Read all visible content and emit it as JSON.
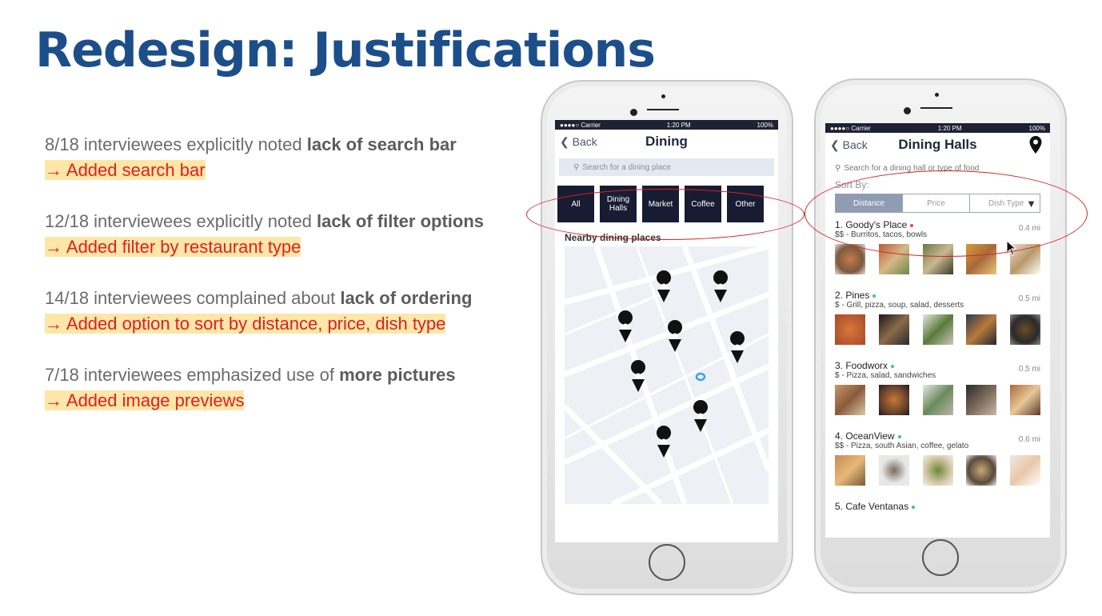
{
  "slide": {
    "title": "Redesign: Justifications"
  },
  "points": [
    {
      "prefix": "8/18 interviewees explicitly noted ",
      "bold": "lack of search bar",
      "result": "→ Added search bar"
    },
    {
      "prefix": "12/18 interviewees explicitly noted ",
      "bold": "lack of filter options",
      "result": "→ Added filter by restaurant type"
    },
    {
      "prefix": "14/18 interviewees complained about ",
      "bold": "lack of ordering",
      "result": "→ Added option to sort by distance, price, dish type"
    },
    {
      "prefix": "7/18 interviewees emphasized use of ",
      "bold": "more pictures",
      "result": "→ Added image previews"
    }
  ],
  "phone1": {
    "status": {
      "carrier": "●●●●○ Carrier",
      "time": "1:20 PM",
      "battery": "100%"
    },
    "back": "Back",
    "title": "Dining",
    "search_placeholder": "Search for a dining place",
    "filters": [
      "All",
      "Dining Halls",
      "Market",
      "Coffee",
      "Other"
    ],
    "nearby_label": "Nearby dining places"
  },
  "phone2": {
    "status": {
      "carrier": "●●●●○ Carrier",
      "time": "1:20 PM",
      "battery": "100%"
    },
    "back": "Back",
    "title": "Dining Halls",
    "search_placeholder": "Search for a dining hall or type of food",
    "sort_label": "Sort By:",
    "sort_options": [
      "Distance",
      "Price",
      "Dish Type"
    ],
    "places": [
      {
        "name": "1. Goody's Place",
        "desc": "$$ - Burritos, tacos, bowls",
        "dist": "0.4 mi",
        "open": false
      },
      {
        "name": "2. Pines",
        "desc": "$ - Grill, pizza, soup, salad, desserts",
        "dist": "0.5 mi",
        "open": true
      },
      {
        "name": "3. Foodworx",
        "desc": "$ - Pizza, salad, sandwiches",
        "dist": "0.5 mi",
        "open": true
      },
      {
        "name": "4. OceanView",
        "desc": "$$ - Pizza, south Asian, coffee, gelato",
        "dist": "0.6 mi",
        "open": true
      },
      {
        "name": "5. Cafe Ventanas",
        "desc": "",
        "dist": "",
        "open": true
      }
    ]
  },
  "colors": {
    "title": "#1c4e8a",
    "highlight": "#fde6a8",
    "result_text": "#e02020",
    "filter_bg": "#181c33",
    "annotation": "#d82020"
  }
}
